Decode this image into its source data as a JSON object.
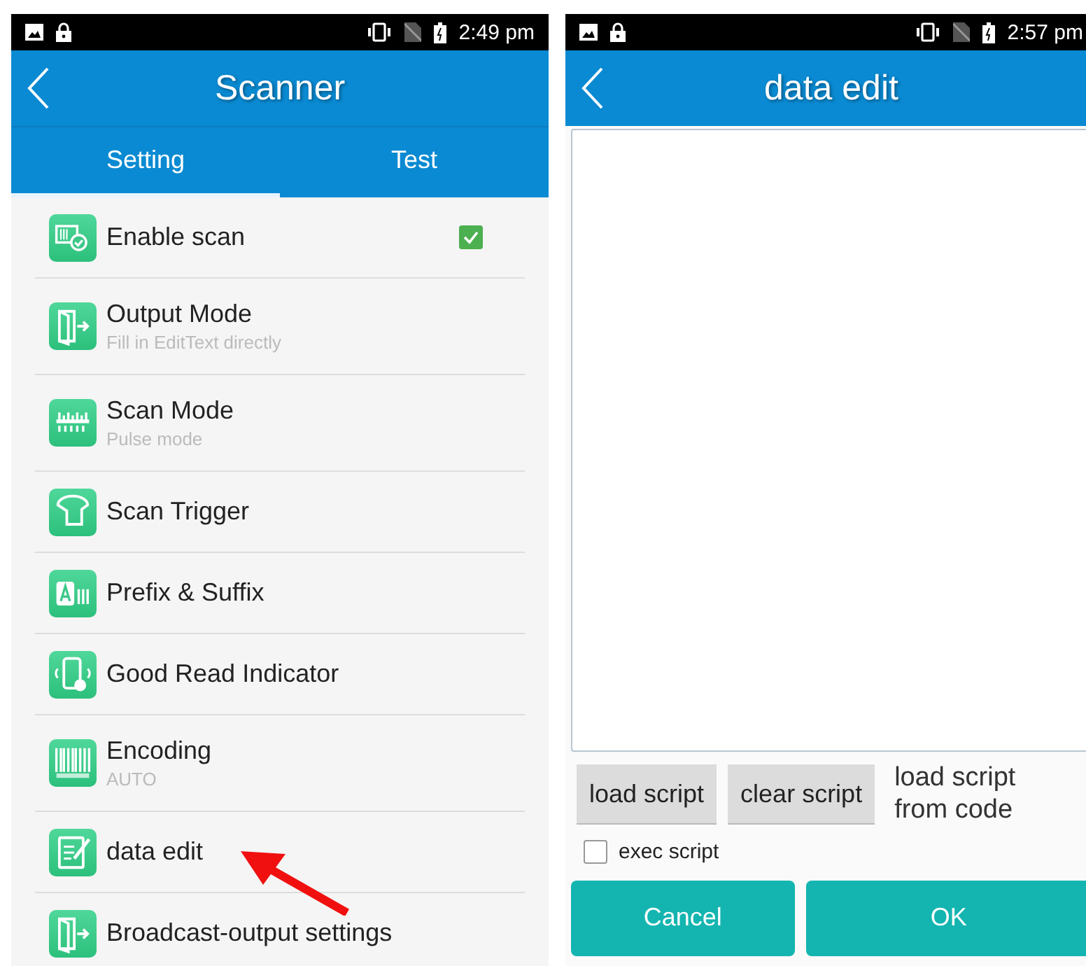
{
  "settings_screen": {
    "status_bar": {
      "time": "2:49 pm"
    },
    "title": "Scanner",
    "tabs": [
      {
        "label": "Setting",
        "selected": true
      },
      {
        "label": "Test",
        "selected": false
      }
    ],
    "items": [
      {
        "kind": "checkbox",
        "title": "Enable scan",
        "checked": true
      },
      {
        "kind": "plain",
        "title": "Output Mode",
        "subtitle": "Fill in EditText directly"
      },
      {
        "kind": "plain",
        "title": "Scan Mode",
        "subtitle": "Pulse mode"
      },
      {
        "kind": "plain",
        "title": "Scan Trigger"
      },
      {
        "kind": "plain",
        "title": "Prefix & Suffix"
      },
      {
        "kind": "plain",
        "title": "Good Read Indicator"
      },
      {
        "kind": "plain",
        "title": "Encoding",
        "subtitle": "AUTO"
      },
      {
        "kind": "plain",
        "title": "data edit"
      },
      {
        "kind": "plain",
        "title": "Broadcast-output settings"
      }
    ]
  },
  "data_edit_screen": {
    "status_bar": {
      "time": "2:57 pm"
    },
    "title": "data edit",
    "script_buttons": [
      "load script",
      "clear script"
    ],
    "note": "load script from code",
    "exec_script": {
      "label": "exec script",
      "checked": false
    },
    "buttons": [
      "Cancel",
      "OK"
    ]
  }
}
